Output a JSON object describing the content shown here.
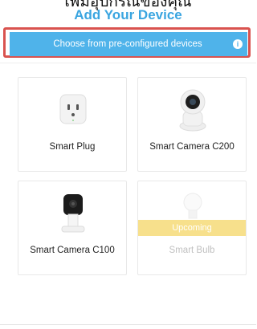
{
  "header": {
    "caption": "เพิ่มอุปกรณ์ของคุณ",
    "title": "Add Your Device"
  },
  "banner": {
    "text": "Choose from pre-configured devices",
    "info_icon": "info-icon",
    "color": "#4fb3ea",
    "highlight_color": "#d9534f"
  },
  "devices": [
    {
      "label": "Smart Plug",
      "icon": "smart-plug-icon",
      "status": "available"
    },
    {
      "label": "Smart Camera C200",
      "icon": "camera-c200-icon",
      "status": "available"
    },
    {
      "label": "Smart Camera C100",
      "icon": "camera-c100-icon",
      "status": "available"
    },
    {
      "label": "Smart Bulb",
      "icon": "smart-bulb-icon",
      "status": "upcoming",
      "badge": "Upcoming"
    }
  ],
  "colors": {
    "accent": "#3aa5e0",
    "badge": "#f7e08c"
  }
}
